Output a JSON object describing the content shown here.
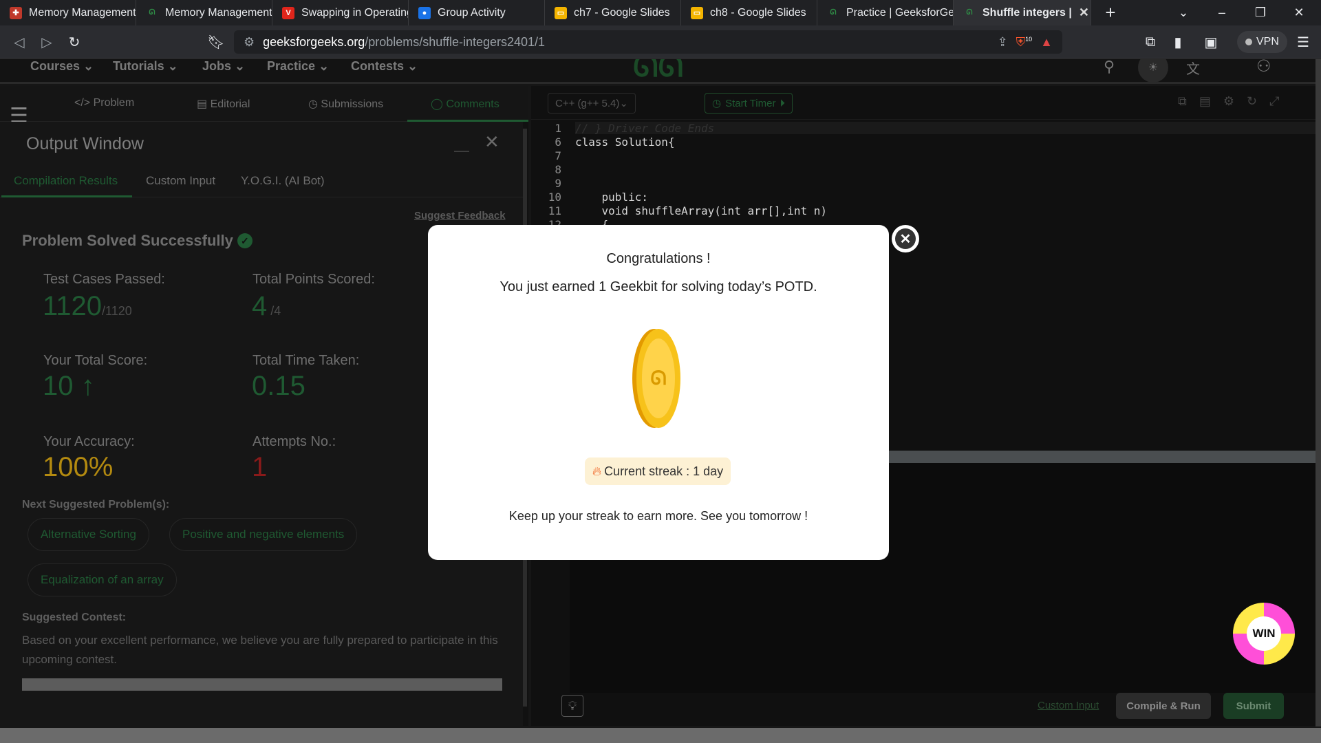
{
  "browser": {
    "tabs": [
      {
        "label": "Memory Management",
        "icon": "adobe-icon",
        "color": "#e8473a"
      },
      {
        "label": "Memory Management",
        "icon": "gfg-icon",
        "color": "#2f8d46"
      },
      {
        "label": "Swapping in Operating",
        "icon": "red-v-icon",
        "color": "#e0251b"
      },
      {
        "label": "Group Activity",
        "icon": "classroom-icon",
        "color": "#1a73e8"
      },
      {
        "label": "ch7 - Google Slides",
        "icon": "slides-icon",
        "color": "#f4b400"
      },
      {
        "label": "ch8 - Google Slides",
        "icon": "slides-icon",
        "color": "#f4b400"
      },
      {
        "label": "Practice | GeeksforGee",
        "icon": "gfg-icon",
        "color": "#2f8d46"
      },
      {
        "label": "Shuffle integers | ",
        "icon": "gfg-icon",
        "color": "#2f8d46"
      }
    ],
    "url_domain": "geeksforgeeks.org",
    "url_path": "/problems/shuffle-integers2401/1",
    "shield_count": "10",
    "vpn_label": "VPN"
  },
  "gfg_nav": {
    "items": [
      "Courses",
      "Tutorials",
      "Jobs",
      "Practice",
      "Contests"
    ]
  },
  "problem_tabs": [
    "Problem",
    "Editorial",
    "Submissions",
    "Comments"
  ],
  "output_window": {
    "title": "Output Window",
    "tabs": [
      "Compilation Results",
      "Custom Input",
      "Y.O.G.I. (AI Bot)"
    ],
    "suggest_feedback": "Suggest Feedback",
    "status": "Problem Solved Successfully",
    "test_cases_label": "Test Cases Passed:",
    "test_cases_value": "1120",
    "test_cases_total": "/1120",
    "points_label": "Total Points Scored:",
    "points_value": "4",
    "points_total": "/4",
    "score_label": "Your Total Score:",
    "score_value": "10",
    "time_label": "Total Time Taken:",
    "time_value": "0.15",
    "accuracy_label": "Your Accuracy:",
    "accuracy_value": "100%",
    "attempts_label": "Attempts No.:",
    "attempts_value": "1",
    "next_label": "Next Suggested Problem(s):",
    "suggested": [
      "Alternative Sorting",
      "Positive and negative elements",
      "Equalization of an array"
    ],
    "contest_label": "Suggested Contest:",
    "contest_text": "Based on your excellent performance, we believe you are fully prepared to participate in this upcoming contest."
  },
  "editor": {
    "language": "C++ (g++ 5.4)",
    "timer": "Start Timer",
    "lines": [
      {
        "num": "1",
        "text": "// } Driver Code Ends"
      },
      {
        "num": "6",
        "text": "class Solution{"
      },
      {
        "num": "7",
        "text": ""
      },
      {
        "num": "8",
        "text": ""
      },
      {
        "num": "9",
        "text": ""
      },
      {
        "num": "10",
        "text": "    public:"
      },
      {
        "num": "11",
        "text": "    void shuffleArray(int arr[],int n)"
      },
      {
        "num": "12",
        "text": "    {"
      }
    ],
    "custom_input": "Custom Input",
    "compile_run": "Compile & Run",
    "submit": "Submit"
  },
  "modal": {
    "title": "Congratulations !",
    "message": "You just earned 1 Geekbit for solving today’s POTD.",
    "streak": "Current streak : 1 day",
    "footer": "Keep up your streak to earn more. See you tomorrow !"
  },
  "win_badge": "WIN",
  "colors": {
    "green": "#2f8d46",
    "accuracy": "#b38a10",
    "attempts": "#8a1a1a",
    "submit_bg": "#1e6b34"
  }
}
